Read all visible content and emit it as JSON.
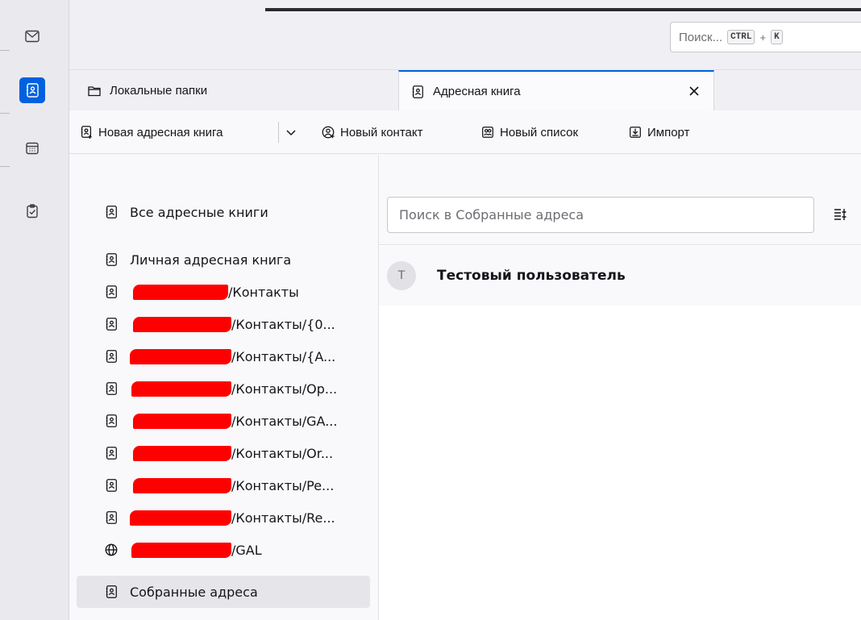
{
  "spaces": {
    "items": [
      {
        "name": "mail-icon"
      },
      {
        "name": "address-book-icon",
        "active": true
      },
      {
        "name": "calendar-icon"
      },
      {
        "name": "tasks-icon"
      }
    ],
    "accent_color": "#0061e0"
  },
  "search": {
    "placeholder": "Поиск...",
    "shortcut_key1": "CTRL",
    "shortcut_plus": "+",
    "shortcut_key2": "K"
  },
  "tabs": [
    {
      "label": "Локальные папки",
      "icon": "folder-icon"
    },
    {
      "label": "Адресная книга",
      "icon": "address-book-icon",
      "active": true,
      "closable": true
    }
  ],
  "toolbar": {
    "new_book_label": "Новая адресная книга",
    "new_contact_label": "Новый контакт",
    "new_list_label": "Новый список",
    "import_label": "Импорт"
  },
  "sidebar": {
    "items": [
      {
        "label": "Все адресные книги",
        "redacted": false
      },
      {
        "label": "Личная адресная книга",
        "redacted": false
      },
      {
        "label": "/Контакты",
        "redacted": true
      },
      {
        "label": "/Контакты/{0...",
        "redacted": true
      },
      {
        "label": "/Контакты/{A...",
        "redacted": true
      },
      {
        "label": "/Контакты/Op...",
        "redacted": true
      },
      {
        "label": "/Контакты/GA...",
        "redacted": true
      },
      {
        "label": "/Контакты/Or...",
        "redacted": true
      },
      {
        "label": "/Контакты/Pe...",
        "redacted": true
      },
      {
        "label": "/Контакты/Re...",
        "redacted": true
      },
      {
        "label": "/GAL",
        "redacted": true,
        "icon": "globe-icon"
      },
      {
        "label": "Собранные адреса",
        "redacted": false,
        "selected": true
      }
    ],
    "redaction_color": "#ff0000"
  },
  "content": {
    "search_placeholder": "Поиск в Собранные адреса",
    "contacts": [
      {
        "initial": "T",
        "name": "Тестовый пользователь"
      }
    ]
  }
}
